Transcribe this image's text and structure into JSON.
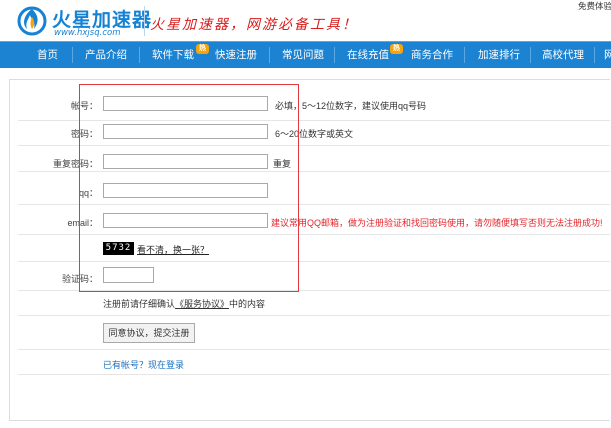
{
  "header": {
    "logo_name": "火星加速器",
    "logo_url": "www.hxjsq.com",
    "slogan": "火星加速器，网游必备工具！",
    "top_right": "免费体验"
  },
  "nav": {
    "items": [
      {
        "label": "首页"
      },
      {
        "label": "产品介绍"
      },
      {
        "label": "软件下载",
        "badge": "热"
      },
      {
        "label": "快速注册"
      },
      {
        "label": "常见问题"
      },
      {
        "label": "在线充值",
        "badge": "热"
      },
      {
        "label": "商务合作"
      },
      {
        "label": "加速排行"
      },
      {
        "label": "高校代理"
      },
      {
        "label": "网"
      }
    ]
  },
  "form": {
    "account": {
      "label": "帐号：",
      "value": "",
      "hint": "必填，5～12位数字，建议使用qq号码"
    },
    "password": {
      "label": "密码：",
      "value": "",
      "hint": "6～20位数字或英文"
    },
    "repeat_password": {
      "label": "重复密码：",
      "value": "",
      "hint": "重复"
    },
    "qq": {
      "label": "qq：",
      "value": ""
    },
    "email": {
      "label": "email：",
      "value": "",
      "hint": "建议常用QQ邮箱，做为注册验证和找回密码使用，请勿随便填写否则无法注册成功!"
    },
    "captcha": {
      "image_text": "5732",
      "refresh_link": "看不清，换一张？"
    },
    "verify_code": {
      "label": "验证码：",
      "value": ""
    },
    "terms": {
      "prefix": "注册前请仔细确认",
      "link": "《服务协议》",
      "suffix": "中的内容"
    },
    "submit_label": "同意协议，提交注册",
    "login_link": "已有帐号？现在登录"
  },
  "colors": {
    "nav_bg": "#1b83d2",
    "brand_blue": "#1582d4",
    "slogan_red": "#d61d1d",
    "hint_red": "#e4252b",
    "link_blue": "#1a6fc0",
    "annotation_box": "#e0393e"
  }
}
